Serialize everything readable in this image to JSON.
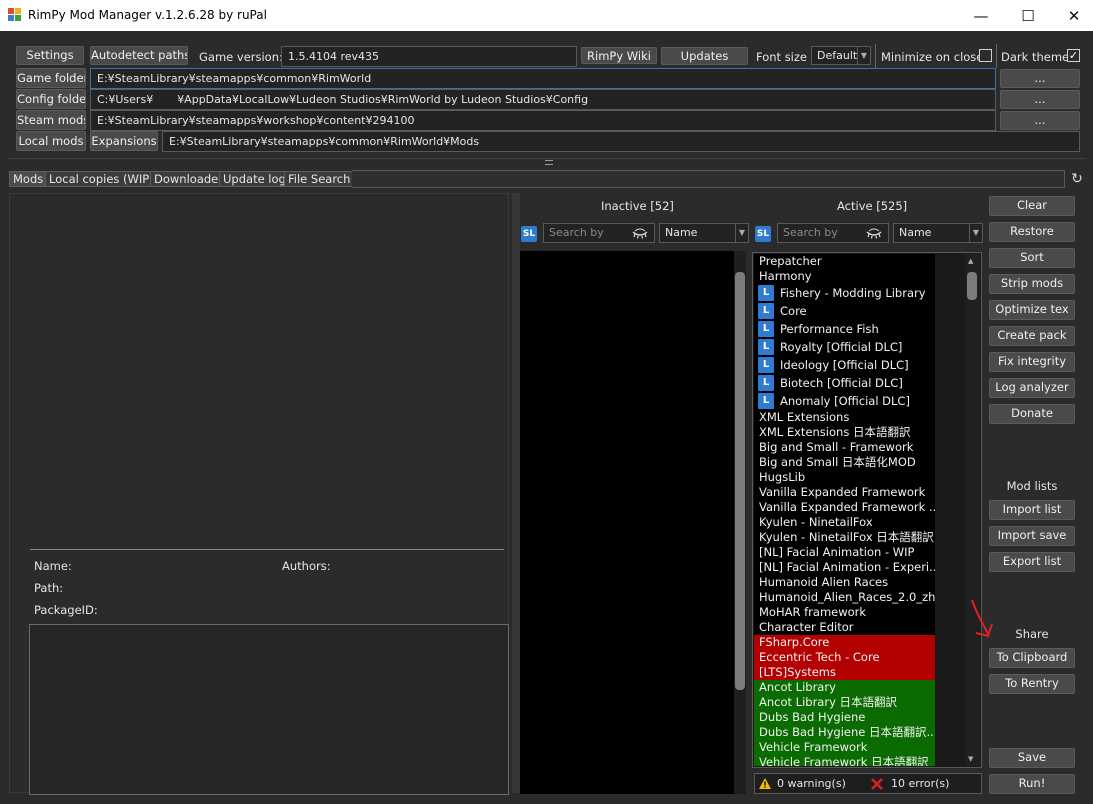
{
  "window": {
    "title": "RimPy Mod Manager v.1.2.6.28 by ruPal",
    "minimize": "—",
    "maximize": "☐",
    "close": "✕"
  },
  "toolbar": {
    "settings": "Settings",
    "autodetect": "Autodetect paths",
    "game_version_label": "Game version:",
    "game_version": "1.5.4104 rev435",
    "wiki": "RimPy Wiki",
    "updates": "Updates",
    "font_size_label": "Font size",
    "font_size": "Default",
    "minimize_on_close": "Minimize on close",
    "minimize_on_close_checked": false,
    "dark_theme": "Dark theme",
    "dark_theme_checked": true
  },
  "paths": {
    "game_folder_label": "Game folder",
    "game_folder": "E:¥SteamLibrary¥steamapps¥common¥RimWorld",
    "config_folder_label": "Config folder",
    "config_folder_a": "C:¥Users¥",
    "config_folder_b": "¥AppData¥LocalLow¥Ludeon Studios¥RimWorld by Ludeon Studios¥Config",
    "steam_mods_label": "Steam mods",
    "steam_mods": "E:¥SteamLibrary¥steamapps¥workshop¥content¥294100",
    "local_mods_label": "Local mods",
    "expansions_label": "Expansions",
    "expansions": "E:¥SteamLibrary¥steamapps¥common¥RimWorld¥Mods",
    "browse": "..."
  },
  "tabs": [
    "Mods",
    "Local copies (WIP)",
    "Downloader",
    "Update log",
    "File Search"
  ],
  "refresh_icon": "↻",
  "info": {
    "name": "Name:",
    "authors": "Authors:",
    "path": "Path:",
    "package_id": "PackageID:"
  },
  "inactive": {
    "title": "Inactive [52]",
    "search_placeholder": "Search by",
    "sort": "Name",
    "sl": "SL"
  },
  "active": {
    "title": "Active [525]",
    "search_placeholder": "Search by",
    "sort": "Name",
    "sl": "SL",
    "items": [
      {
        "label": "Prepatcher",
        "kind": "plain"
      },
      {
        "label": "Harmony",
        "kind": "plain"
      },
      {
        "label": "Fishery - Modding Library",
        "kind": "local"
      },
      {
        "label": "Core",
        "kind": "local"
      },
      {
        "label": "Performance Fish",
        "kind": "local"
      },
      {
        "label": "Royalty [Official DLC]",
        "kind": "local"
      },
      {
        "label": "Ideology [Official DLC]",
        "kind": "local"
      },
      {
        "label": "Biotech [Official DLC]",
        "kind": "local"
      },
      {
        "label": "Anomaly [Official DLC]",
        "kind": "local"
      },
      {
        "label": "XML Extensions",
        "kind": "plain"
      },
      {
        "label": "XML Extensions 日本語翻訳",
        "kind": "plain"
      },
      {
        "label": "Big and Small - Framework",
        "kind": "plain"
      },
      {
        "label": "Big and Small 日本語化MOD",
        "kind": "plain"
      },
      {
        "label": "HugsLib",
        "kind": "plain"
      },
      {
        "label": "Vanilla Expanded Framework",
        "kind": "plain"
      },
      {
        "label": "Vanilla Expanded Framework ...",
        "kind": "plain"
      },
      {
        "label": "Kyulen - NinetailFox",
        "kind": "plain"
      },
      {
        "label": "Kyulen - NinetailFox 日本語翻訳",
        "kind": "plain"
      },
      {
        "label": "[NL] Facial Animation - WIP",
        "kind": "plain"
      },
      {
        "label": "[NL] Facial Animation - Experi...",
        "kind": "plain"
      },
      {
        "label": "Humanoid Alien Races",
        "kind": "plain"
      },
      {
        "label": "Humanoid_Alien_Races_2.0_zh",
        "kind": "plain"
      },
      {
        "label": "MoHAR framework",
        "kind": "plain"
      },
      {
        "label": "Character Editor",
        "kind": "plain"
      },
      {
        "label": "FSharp.Core",
        "kind": "red"
      },
      {
        "label": "Eccentric Tech - Core",
        "kind": "red"
      },
      {
        "label": "[LTS]Systems",
        "kind": "red"
      },
      {
        "label": "Ancot Library",
        "kind": "green"
      },
      {
        "label": "Ancot Library 日本語翻訳",
        "kind": "green"
      },
      {
        "label": "Dubs Bad Hygiene",
        "kind": "green"
      },
      {
        "label": "Dubs Bad Hygiene 日本語翻訳...",
        "kind": "green"
      },
      {
        "label": "Vehicle Framework",
        "kind": "green"
      },
      {
        "label": "Vehicle Framework 日本語翻訳",
        "kind": "green"
      }
    ],
    "local_badge": "L"
  },
  "status": {
    "warnings": "0 warning(s)",
    "errors": "10 error(s)"
  },
  "side": {
    "clear": "Clear",
    "restore": "Restore",
    "sort": "Sort",
    "strip_mods": "Strip mods",
    "optimize_tex": "Optimize tex",
    "create_pack": "Create pack",
    "fix_integrity": "Fix integrity",
    "log_analyzer": "Log analyzer",
    "donate": "Donate",
    "mod_lists": "Mod lists",
    "import_list": "Import list",
    "import_save": "Import save",
    "export_list": "Export list",
    "share": "Share",
    "to_clipboard": "To Clipboard",
    "to_rentry": "To Rentry",
    "save": "Save",
    "run": "Run!"
  },
  "colors": {
    "error_row": "#b30000",
    "ok_row": "#0a6b00",
    "accent": "#2e7bd1",
    "annotation_arrow": "#e02020"
  }
}
